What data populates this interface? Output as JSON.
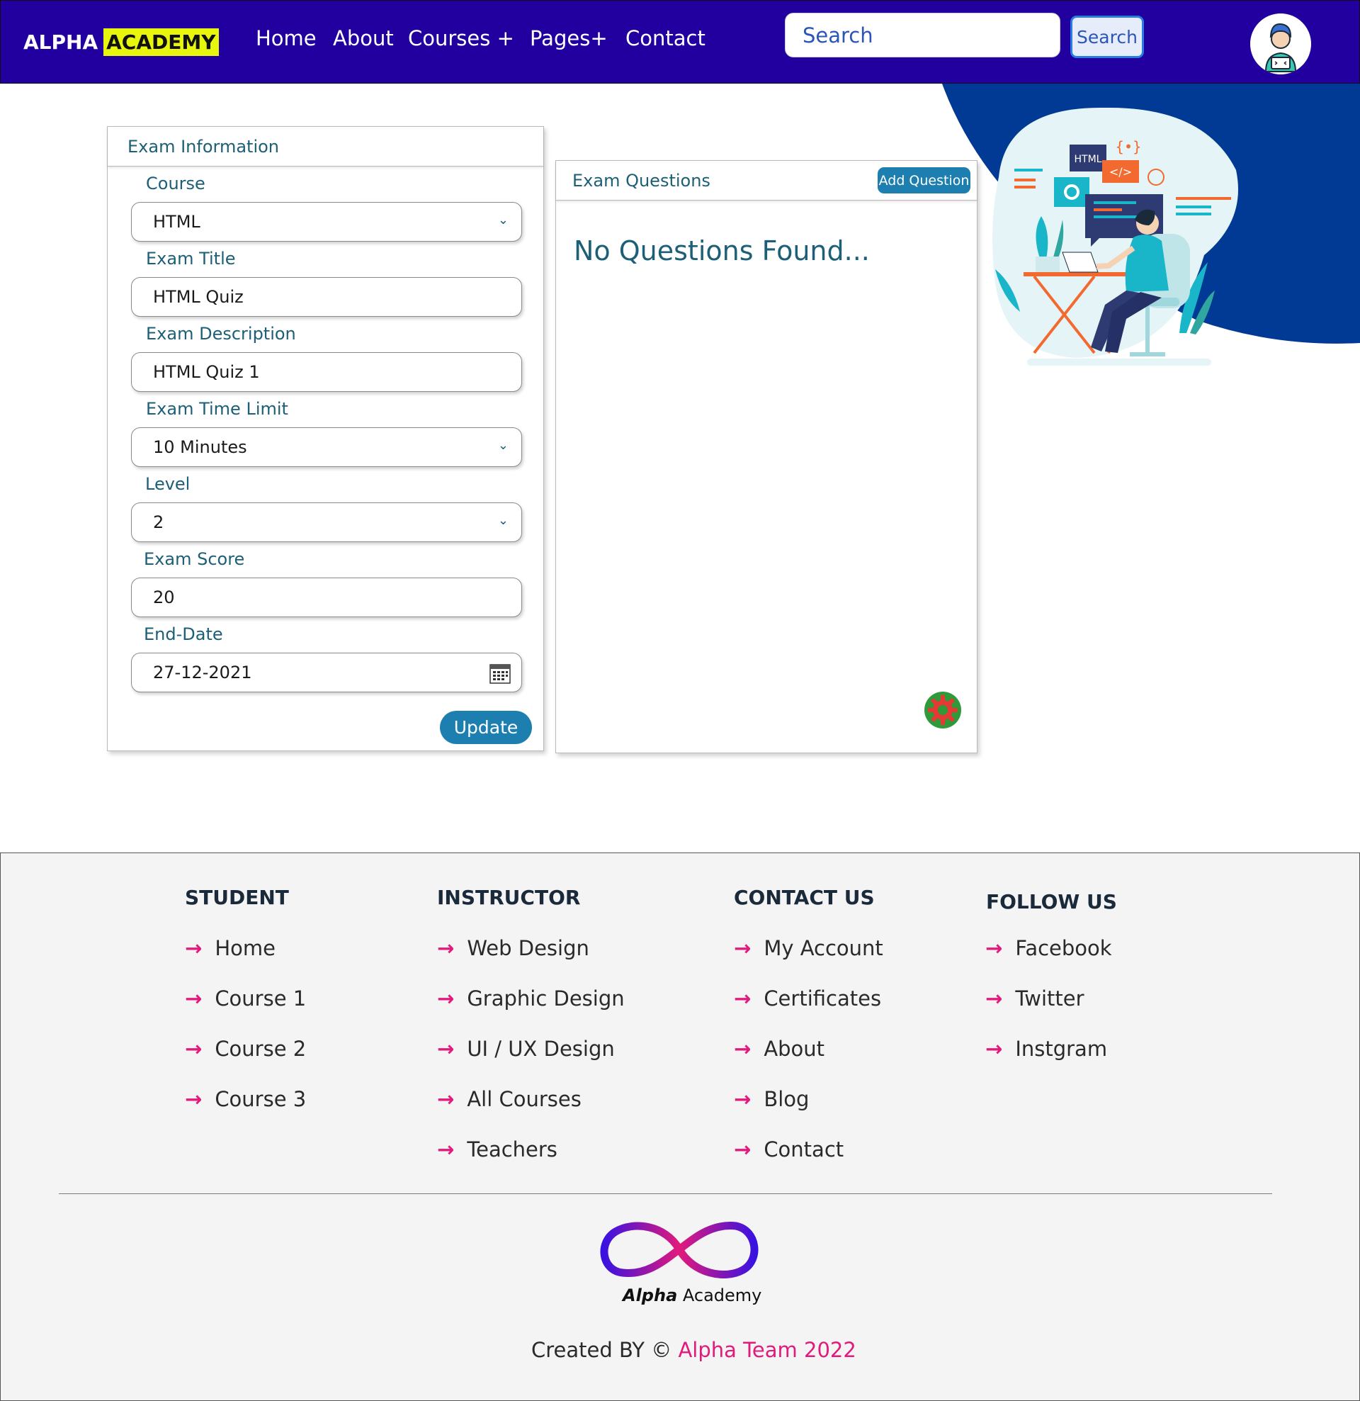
{
  "navbar": {
    "brand_part1": "ALPHA",
    "brand_part2": "ACADEMY",
    "links": [
      "Home",
      "About",
      "Courses +",
      "Pages+",
      "Contact"
    ],
    "search_placeholder": "Search",
    "search_button": "Search"
  },
  "exam_info": {
    "title": "Exam Information",
    "fields": [
      {
        "label": "Course",
        "value": "HTML"
      },
      {
        "label": "Exam Title",
        "value": "HTML Quiz"
      },
      {
        "label": "Exam Description",
        "value": "HTML Quiz 1"
      },
      {
        "label": "Exam Time Limit",
        "value": "10 Minutes"
      },
      {
        "label": "Level",
        "value": "2"
      },
      {
        "label": "Exam Score",
        "value": "20"
      },
      {
        "label": "End-Date",
        "value": "27-12-2021"
      }
    ],
    "update_button": "Update"
  },
  "exam_questions": {
    "title": "Exam Questions",
    "add_button": "Add Question",
    "empty_message": "No Questions Found..."
  },
  "illustration": {
    "badge_text": "HTML",
    "code_symbol": "</>",
    "bracket_symbol": "{•}"
  },
  "footer": {
    "columns": [
      {
        "title": "STUDENT",
        "items": [
          "Home",
          "Course 1",
          "Course 2",
          "Course 3"
        ]
      },
      {
        "title": "INSTRUCTOR",
        "items": [
          "Web Design",
          "Graphic Design",
          "UI / UX Design",
          "All Courses",
          "Teachers"
        ]
      },
      {
        "title": "CONTACT US",
        "items": [
          "My Account",
          "Certificates",
          "About",
          "Blog",
          "Contact"
        ]
      },
      {
        "title": "FOLLOW US",
        "items": [
          "Facebook",
          "Twitter",
          "Instgram"
        ]
      }
    ],
    "arrow": "→",
    "logo_text_bold": "Alpha",
    "logo_text": "Academy",
    "copyright_prefix": "Created BY ©",
    "copyright_team": "Alpha Team 2022"
  },
  "colors": {
    "navbar": "#2200a0",
    "brand_highlight": "#e8f50c",
    "accent_blue": "#1d7fb0",
    "label_teal": "#1c5f77",
    "footer_accent": "#e11a7c",
    "blob": "#003a94"
  }
}
